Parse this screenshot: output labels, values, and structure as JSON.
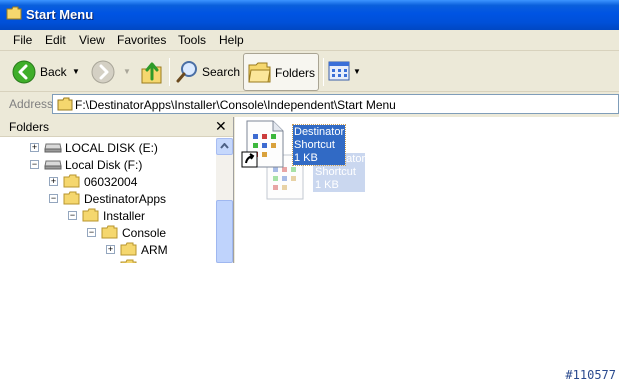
{
  "window": {
    "title": "Start Menu"
  },
  "menu": [
    "File",
    "Edit",
    "View",
    "Favorites",
    "Tools",
    "Help"
  ],
  "toolbar": {
    "back_label": "Back",
    "search_label": "Search",
    "folders_label": "Folders"
  },
  "address": {
    "label": "Address",
    "path": "F:\\DestinatorApps\\Installer\\Console\\Independent\\Start Menu"
  },
  "folders_pane": {
    "title": "Folders",
    "close": "✕",
    "tree": [
      {
        "label": "LOCAL DISK (E:)",
        "toggle": "+"
      },
      {
        "label": "Local Disk (F:)",
        "toggle": "−"
      },
      {
        "label": "06032004",
        "toggle": "+"
      },
      {
        "label": "DestinatorApps",
        "toggle": "−"
      },
      {
        "label": "Installer",
        "toggle": "−"
      },
      {
        "label": "Console",
        "toggle": "−"
      },
      {
        "label": "ARM",
        "toggle": "+"
      }
    ]
  },
  "files": [
    {
      "name": "Destinator",
      "type": "Shortcut",
      "size": "1 KB",
      "selected": true
    },
    {
      "name": "Destinator",
      "type": "Shortcut",
      "size": "1 KB",
      "drag_ghost": true
    }
  ],
  "footer": {
    "id": "#110577"
  },
  "colors": {
    "titlebar": "#0054e3",
    "selection": "#316ac5",
    "folder": "#f5d76e"
  }
}
